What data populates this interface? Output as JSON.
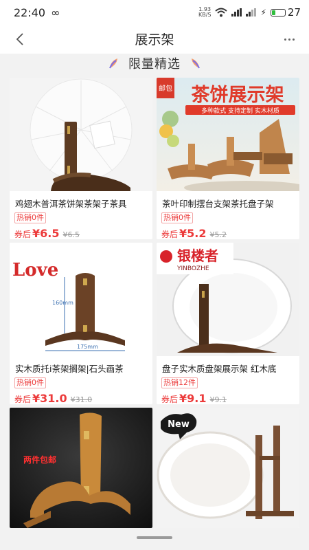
{
  "status_bar": {
    "time": "22:40",
    "speed_value": "1.93",
    "speed_unit": "KB/S",
    "battery": "27"
  },
  "nav": {
    "title": "展示架"
  },
  "section": {
    "title": "限量精选"
  },
  "products": [
    {
      "title": "鸡翅木普洱茶饼架茶架子茶具",
      "sold": "热销0件",
      "prefix": "券后",
      "price": "¥6.5",
      "old_price": "¥6.5"
    },
    {
      "title": "茶叶印制摆台支架茶托盘子架",
      "sold": "热销0件",
      "prefix": "券后",
      "price": "¥5.2",
      "old_price": "¥5.2",
      "image_text": {
        "badge": "邮包",
        "banner": "茶饼展示架",
        "sub": "多种款式 支持定制 实木材质"
      }
    },
    {
      "title": "实木质托i茶架搁架|石头画茶",
      "sold": "热销0件",
      "prefix": "券后",
      "price": "¥31.0",
      "old_price": "¥31.0",
      "image_text": {
        "label_a": "160mm",
        "label_b": "175mm"
      }
    },
    {
      "title": "盘子实木质盘架展示架 红木底",
      "sold": "热销12件",
      "prefix": "券后",
      "price": "¥9.1",
      "old_price": "¥9.1",
      "image_text": {
        "brand_cn": "银楼者",
        "brand_en": "YINBOZHE"
      }
    },
    {
      "image_text": {
        "promo": "两件包邮"
      }
    },
    {
      "image_text": {
        "sticker": "New"
      }
    }
  ]
}
